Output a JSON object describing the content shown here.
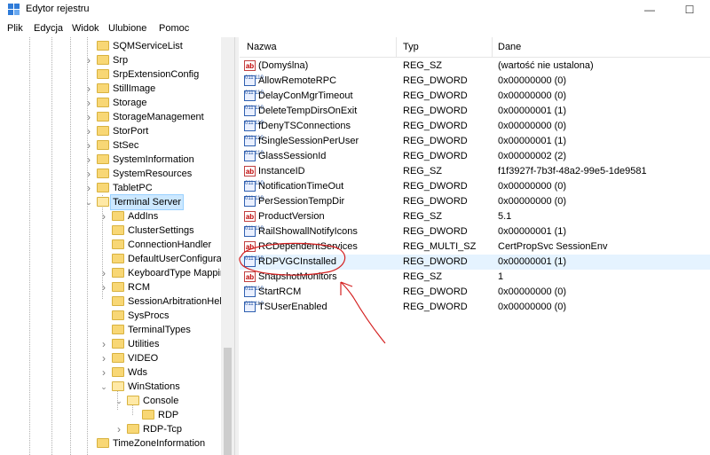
{
  "window": {
    "title": "Edytor rejestru",
    "minimize_glyph": "—",
    "maximize_glyph": "☐"
  },
  "menu": [
    "Plik",
    "Edycja",
    "Widok",
    "Ulubione",
    "Pomoc"
  ],
  "tree": {
    "items": [
      {
        "label": "SQMServiceList",
        "depth": 0,
        "expander": "none"
      },
      {
        "label": "Srp",
        "depth": 0,
        "expander": "collapsed"
      },
      {
        "label": "SrpExtensionConfig",
        "depth": 0,
        "expander": "none"
      },
      {
        "label": "StillImage",
        "depth": 0,
        "expander": "collapsed"
      },
      {
        "label": "Storage",
        "depth": 0,
        "expander": "collapsed"
      },
      {
        "label": "StorageManagement",
        "depth": 0,
        "expander": "collapsed"
      },
      {
        "label": "StorPort",
        "depth": 0,
        "expander": "collapsed"
      },
      {
        "label": "StSec",
        "depth": 0,
        "expander": "collapsed"
      },
      {
        "label": "SystemInformation",
        "depth": 0,
        "expander": "collapsed"
      },
      {
        "label": "SystemResources",
        "depth": 0,
        "expander": "collapsed"
      },
      {
        "label": "TabletPC",
        "depth": 0,
        "expander": "collapsed"
      },
      {
        "label": "Terminal Server",
        "depth": 0,
        "expander": "expanded",
        "selected": true
      },
      {
        "label": "AddIns",
        "depth": 1,
        "expander": "collapsed"
      },
      {
        "label": "ClusterSettings",
        "depth": 1,
        "expander": "none"
      },
      {
        "label": "ConnectionHandler",
        "depth": 1,
        "expander": "none"
      },
      {
        "label": "DefaultUserConfigurat",
        "depth": 1,
        "expander": "none"
      },
      {
        "label": "KeyboardType Mappin",
        "depth": 1,
        "expander": "collapsed"
      },
      {
        "label": "RCM",
        "depth": 1,
        "expander": "collapsed"
      },
      {
        "label": "SessionArbitrationHelp",
        "depth": 1,
        "expander": "none"
      },
      {
        "label": "SysProcs",
        "depth": 1,
        "expander": "none"
      },
      {
        "label": "TerminalTypes",
        "depth": 1,
        "expander": "none"
      },
      {
        "label": "Utilities",
        "depth": 1,
        "expander": "collapsed"
      },
      {
        "label": "VIDEO",
        "depth": 1,
        "expander": "collapsed"
      },
      {
        "label": "Wds",
        "depth": 1,
        "expander": "collapsed"
      },
      {
        "label": "WinStations",
        "depth": 1,
        "expander": "expanded"
      },
      {
        "label": "Console",
        "depth": 2,
        "expander": "expanded"
      },
      {
        "label": "RDP",
        "depth": 3,
        "expander": "none"
      },
      {
        "label": "RDP-Tcp",
        "depth": 2,
        "expander": "collapsed"
      },
      {
        "label": "TimeZoneInformation",
        "depth": 0,
        "expander": "none"
      }
    ]
  },
  "list": {
    "columns": [
      "Nazwa",
      "Typ",
      "Dane"
    ],
    "rows": [
      {
        "name": "(Domyślna)",
        "type": "REG_SZ",
        "data": "(wartość nie ustalona)",
        "icon": "string-value-icon"
      },
      {
        "name": "AllowRemoteRPC",
        "type": "REG_DWORD",
        "data": "0x00000000 (0)",
        "icon": "dword-value-icon"
      },
      {
        "name": "DelayConMgrTimeout",
        "type": "REG_DWORD",
        "data": "0x00000000 (0)",
        "icon": "dword-value-icon"
      },
      {
        "name": "DeleteTempDirsOnExit",
        "type": "REG_DWORD",
        "data": "0x00000001 (1)",
        "icon": "dword-value-icon"
      },
      {
        "name": "fDenyTSConnections",
        "type": "REG_DWORD",
        "data": "0x00000000 (0)",
        "icon": "dword-value-icon"
      },
      {
        "name": "fSingleSessionPerUser",
        "type": "REG_DWORD",
        "data": "0x00000001 (1)",
        "icon": "dword-value-icon"
      },
      {
        "name": "GlassSessionId",
        "type": "REG_DWORD",
        "data": "0x00000002 (2)",
        "icon": "dword-value-icon"
      },
      {
        "name": "InstanceID",
        "type": "REG_SZ",
        "data": "f1f3927f-7b3f-48a2-99e5-1de9581",
        "icon": "string-value-icon"
      },
      {
        "name": "NotificationTimeOut",
        "type": "REG_DWORD",
        "data": "0x00000000 (0)",
        "icon": "dword-value-icon"
      },
      {
        "name": "PerSessionTempDir",
        "type": "REG_DWORD",
        "data": "0x00000000 (0)",
        "icon": "dword-value-icon"
      },
      {
        "name": "ProductVersion",
        "type": "REG_SZ",
        "data": "5.1",
        "icon": "string-value-icon"
      },
      {
        "name": "RailShowallNotifyIcons",
        "type": "REG_DWORD",
        "data": "0x00000001 (1)",
        "icon": "dword-value-icon"
      },
      {
        "name": "RCDependentServices",
        "type": "REG_MULTI_SZ",
        "data": "CertPropSvc SessionEnv",
        "icon": "string-value-icon"
      },
      {
        "name": "RDPVGCInstalled",
        "type": "REG_DWORD",
        "data": "0x00000001 (1)",
        "icon": "dword-value-icon",
        "selected": true
      },
      {
        "name": "SnapshotMonitors",
        "type": "REG_SZ",
        "data": "1",
        "icon": "string-value-icon"
      },
      {
        "name": "StartRCM",
        "type": "REG_DWORD",
        "data": "0x00000000 (0)",
        "icon": "dword-value-icon"
      },
      {
        "name": "TSUserEnabled",
        "type": "REG_DWORD",
        "data": "0x00000000 (0)",
        "icon": "dword-value-icon"
      }
    ]
  },
  "colors": {
    "selection": "#cce8ff",
    "annotation": "#d42020",
    "folder": "#f8d775"
  }
}
